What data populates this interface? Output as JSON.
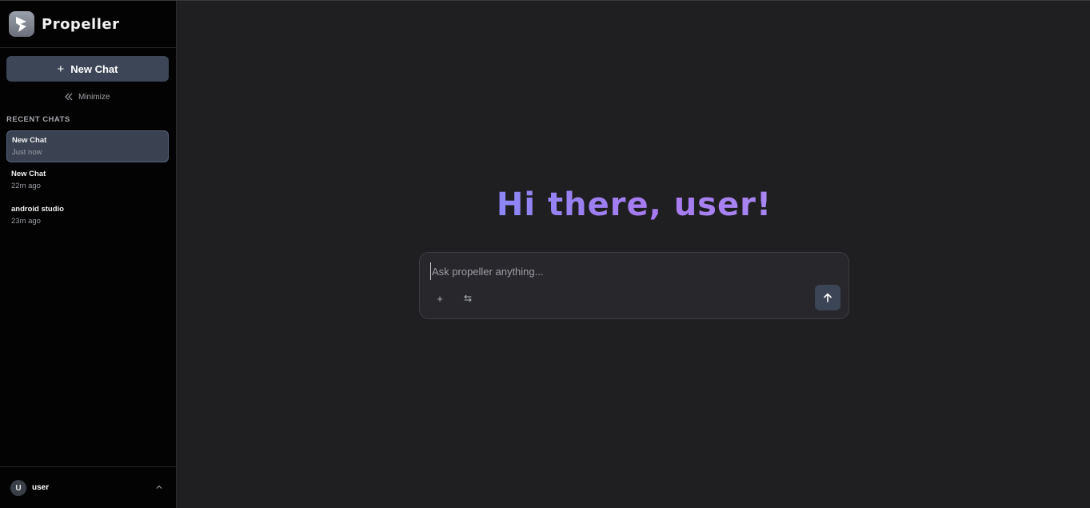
{
  "brand": {
    "name": "Propeller",
    "logo_icon": "propeller-logo-icon"
  },
  "sidebar": {
    "new_chat_label": "New Chat",
    "new_chat_icon": "+",
    "minimize_label": "Minimize",
    "recent_title": "RECENT CHATS",
    "chats": [
      {
        "title": "New Chat",
        "time": "Just now",
        "active": true
      },
      {
        "title": "New Chat",
        "time": "22m ago",
        "active": false
      },
      {
        "title": "android studio",
        "time": "23m ago",
        "active": false
      }
    ]
  },
  "user": {
    "initial": "U",
    "name": "user"
  },
  "main": {
    "greeting": "Hi there, user!",
    "composer": {
      "placeholder": "Ask propeller anything...",
      "attach_icon": "+",
      "tools_icon": "⇆"
    }
  },
  "colors": {
    "accent": "#3d4656",
    "greeting_start": "#7f8cf6",
    "greeting_end": "#a88ef6",
    "background": "#1f1f22",
    "sidebar": "#030303"
  }
}
